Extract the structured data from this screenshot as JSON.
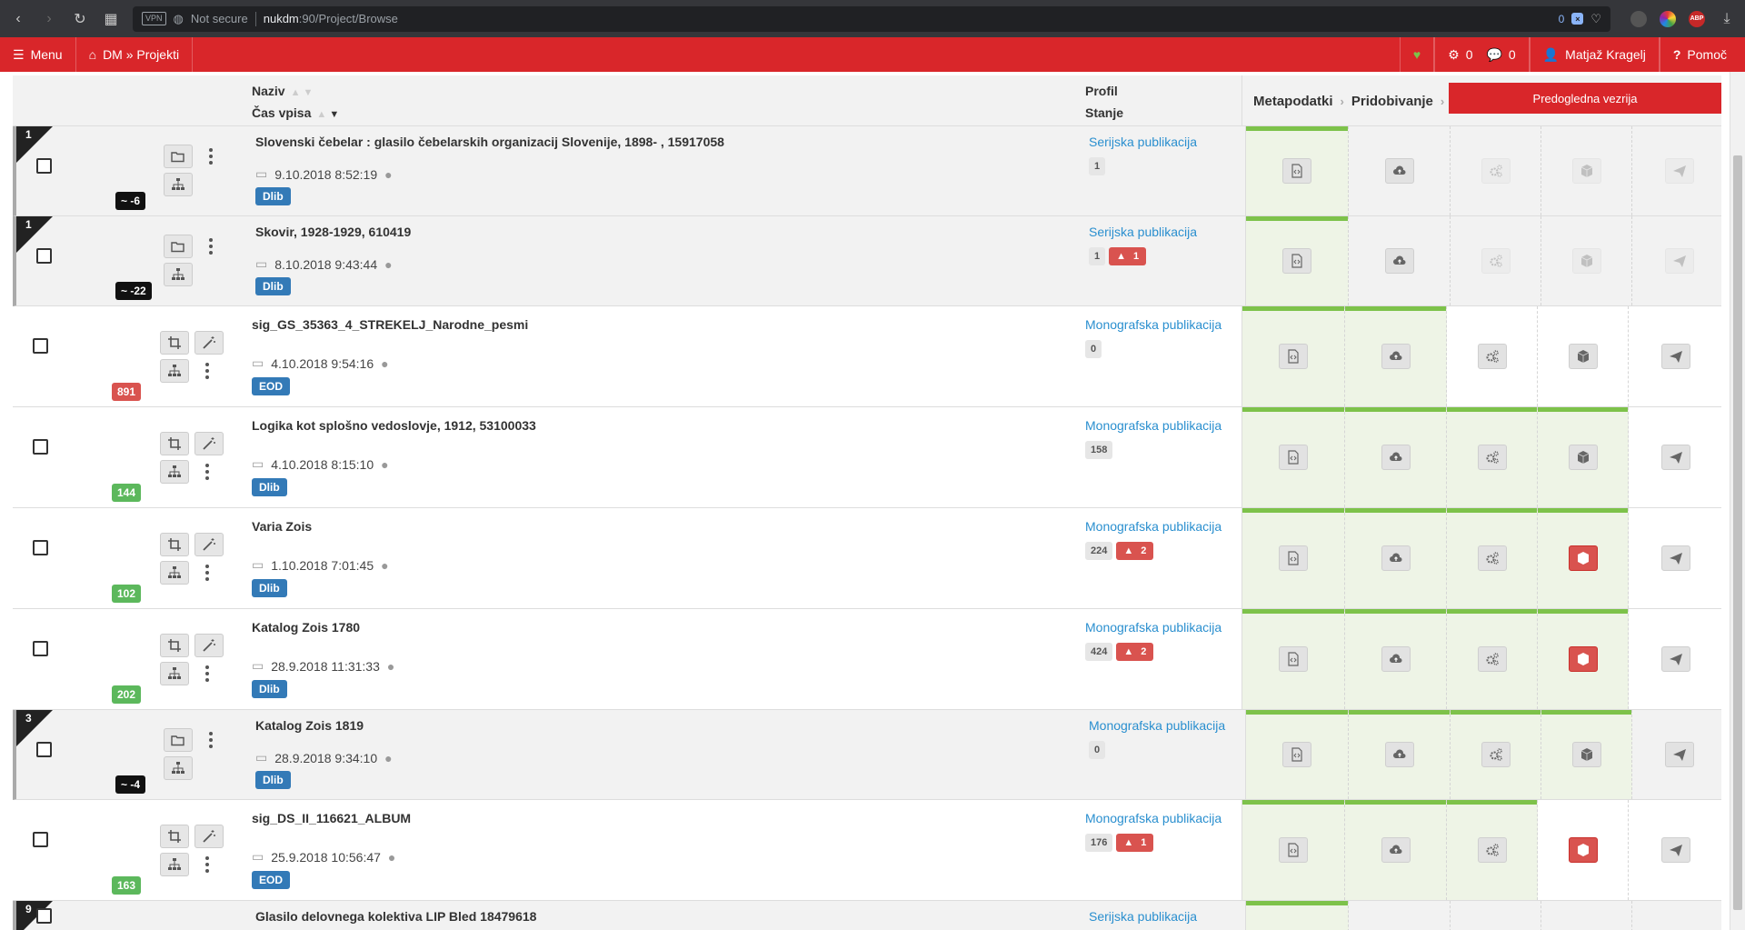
{
  "browser": {
    "vpn_label": "VPN",
    "security_text": "Not secure",
    "url_host": "nukdm",
    "url_path": ":90/Project/Browse",
    "ext_badge": "0",
    "abp_label": "ABP"
  },
  "header": {
    "menu_label": "Menu",
    "breadcrumb": "DM » Projekti",
    "tasks_count": "0",
    "comments_count": "0",
    "user_name": "Matjaž Kragelj",
    "help_label": "Pomoč"
  },
  "columns": {
    "naziv": "Naziv",
    "cas_vpisa": "Čas vpisa",
    "profil": "Profil",
    "stanje": "Stanje",
    "metapodatki": "Metapodatki",
    "pridobivanje": "Pridobivanje",
    "preview_button": "Predogledna vezrija"
  },
  "rows": [
    {
      "group": "1",
      "count": "~ -6",
      "title": "Slovenski čebelar : glasilo čebelarskih organizacij Slovenije, 1898- , 15917058",
      "date": "9.10.2018 8:52:19",
      "tag": "Dlib",
      "profile": "Serijska publikacija",
      "stanje": "1",
      "warnings": ""
    },
    {
      "group": "1",
      "count": "~ -22",
      "title": "Skovir, 1928-1929, 610419",
      "date": "8.10.2018 9:43:44",
      "tag": "Dlib",
      "profile": "Serijska publikacija",
      "stanje": "1",
      "warnings": "1"
    },
    {
      "group": "",
      "count": "891",
      "title": "sig_GS_35363_4_STREKELJ_Narodne_pesmi",
      "date": "4.10.2018 9:54:16",
      "tag": "EOD",
      "profile": "Monografska publikacija",
      "stanje": "0",
      "warnings": ""
    },
    {
      "group": "",
      "count": "144",
      "title": "Logika kot splošno vedoslovje, 1912, 53100033",
      "date": "4.10.2018 8:15:10",
      "tag": "Dlib",
      "profile": "Monografska publikacija",
      "stanje": "158",
      "warnings": ""
    },
    {
      "group": "",
      "count": "102",
      "title": "Varia Zois",
      "date": "1.10.2018 7:01:45",
      "tag": "Dlib",
      "profile": "Monografska publikacija",
      "stanje": "224",
      "warnings": "2"
    },
    {
      "group": "",
      "count": "202",
      "title": "Katalog Zois 1780",
      "date": "28.9.2018 11:31:33",
      "tag": "Dlib",
      "profile": "Monografska publikacija",
      "stanje": "424",
      "warnings": "2"
    },
    {
      "group": "3",
      "count": "~ -4",
      "title": "Katalog Zois 1819",
      "date": "28.9.2018 9:34:10",
      "tag": "Dlib",
      "profile": "Monografska publikacija",
      "stanje": "0",
      "warnings": ""
    },
    {
      "group": "",
      "count": "163",
      "title": "sig_DS_II_116621_ALBUM",
      "date": "25.9.2018 10:56:47",
      "tag": "EOD",
      "profile": "Monografska publikacija",
      "stanje": "176",
      "warnings": "1"
    },
    {
      "group": "9",
      "count": "",
      "title": "Glasilo delovnega kolektiva LIP Bled 18479618",
      "date": "",
      "tag": "",
      "profile": "Serijska publikacija",
      "stanje": "",
      "warnings": ""
    }
  ]
}
